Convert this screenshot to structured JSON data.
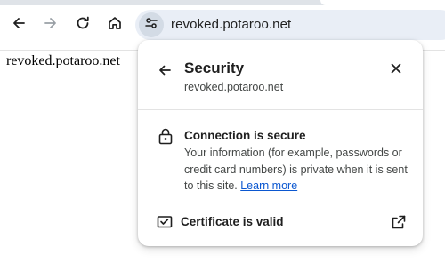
{
  "browser": {
    "url": "revoked.potaroo.net",
    "icons": {
      "back": "back-arrow-icon",
      "forward": "forward-arrow-icon",
      "reload": "reload-icon",
      "home": "home-icon",
      "site_info": "tune-icon"
    }
  },
  "page": {
    "body_text": "revoked.potaroo.net"
  },
  "popup": {
    "title": "Security",
    "subtitle": "revoked.potaroo.net",
    "connection": {
      "title": "Connection is secure",
      "description": "Your information (for example, passwords or credit card numbers) is private when it is sent to this site.",
      "learn_more": "Learn more"
    },
    "certificate": {
      "label": "Certificate is valid"
    },
    "icons": {
      "back": "back-arrow-icon",
      "close": "close-icon",
      "lock": "lock-icon",
      "certificate": "certificate-icon",
      "external": "open-external-icon"
    }
  },
  "colors": {
    "link": "#0b57d0",
    "omnibox_bg": "#e9eef6",
    "text_primary": "#1f1f1f",
    "text_secondary": "#444746"
  }
}
